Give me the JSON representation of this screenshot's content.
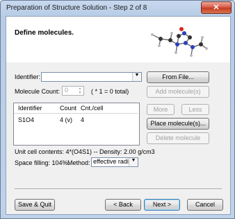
{
  "window": {
    "title": "Preparation of Structure Solution - Step 2 of 8",
    "close": "✕"
  },
  "page": {
    "heading": "Define molecules."
  },
  "identifier": {
    "label": "Identifier:",
    "value": ""
  },
  "count": {
    "label": "Molecule Count:",
    "value": "0",
    "note": "( * 1 = 0 total)"
  },
  "list": {
    "headers": [
      "Identifier",
      "Count",
      "Cnt./cell"
    ],
    "rows": [
      {
        "identifier": "S1O4",
        "count": "4 (v)",
        "cnt_cell": "4"
      }
    ]
  },
  "buttons": {
    "from_file": "From File...",
    "add_molecule": "Add molecule(s)",
    "more": "More",
    "less": "Less",
    "place_molecule": "Place molecule(s)...",
    "delete_molecule": "Delete molecule",
    "save_quit": "Save & Quit",
    "back": "< Back",
    "next": "Next >",
    "cancel": "Cancel"
  },
  "info": {
    "unit_cell": "Unit cell contents: 4*(O4S1) -- Density: 2.00 g/cm3",
    "space_filling": "Space filling: 104%.",
    "method_label": "Method:",
    "method_value": "effective radii"
  },
  "icons": [
    "close-icon",
    "molecule-preview-image",
    "dropdown-arrow-icon",
    "spin-up-icon",
    "spin-down-icon"
  ]
}
